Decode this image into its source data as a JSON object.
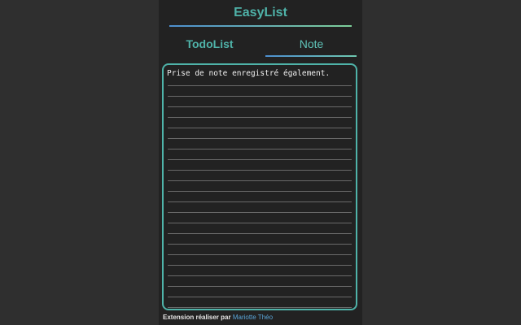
{
  "app": {
    "title": "EasyList"
  },
  "tabs": [
    {
      "label": "TodoList",
      "active": false
    },
    {
      "label": "Note",
      "active": true
    }
  ],
  "note": {
    "content": "Prise de note enregistré également."
  },
  "footer": {
    "label": "Extension réaliser par",
    "author": "Mariotte Théo"
  },
  "colors": {
    "accent": "#4fb3a9",
    "gradient_start": "#4d8fd0",
    "gradient_end": "#7ed09a",
    "background": "#222222",
    "outer_background": "#2f2f2f",
    "link": "#5aa6d9"
  }
}
